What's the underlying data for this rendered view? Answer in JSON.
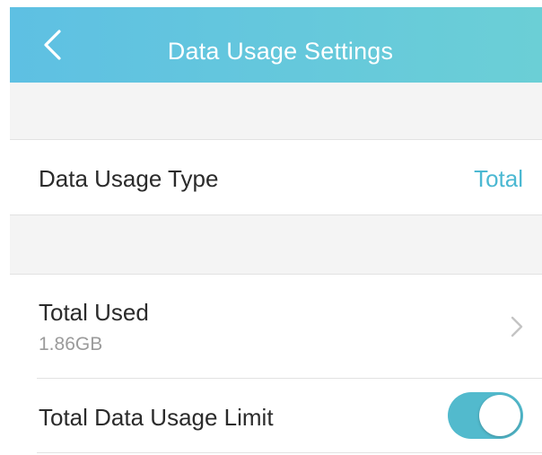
{
  "header": {
    "title": "Data Usage Settings",
    "back_icon": "chevron-left-icon",
    "gradient_start": "#5ec0e3",
    "gradient_end": "#6bcfd6"
  },
  "settings": {
    "data_usage_type": {
      "label": "Data Usage Type",
      "value": "Total",
      "value_color": "#4bb8d2"
    },
    "total_used": {
      "label": "Total Used",
      "value": "1.86GB",
      "icon": "chevron-right-icon"
    },
    "total_data_usage_limit": {
      "label": "Total Data Usage Limit",
      "toggle_on": true,
      "toggle_color": "#52bacd"
    }
  }
}
